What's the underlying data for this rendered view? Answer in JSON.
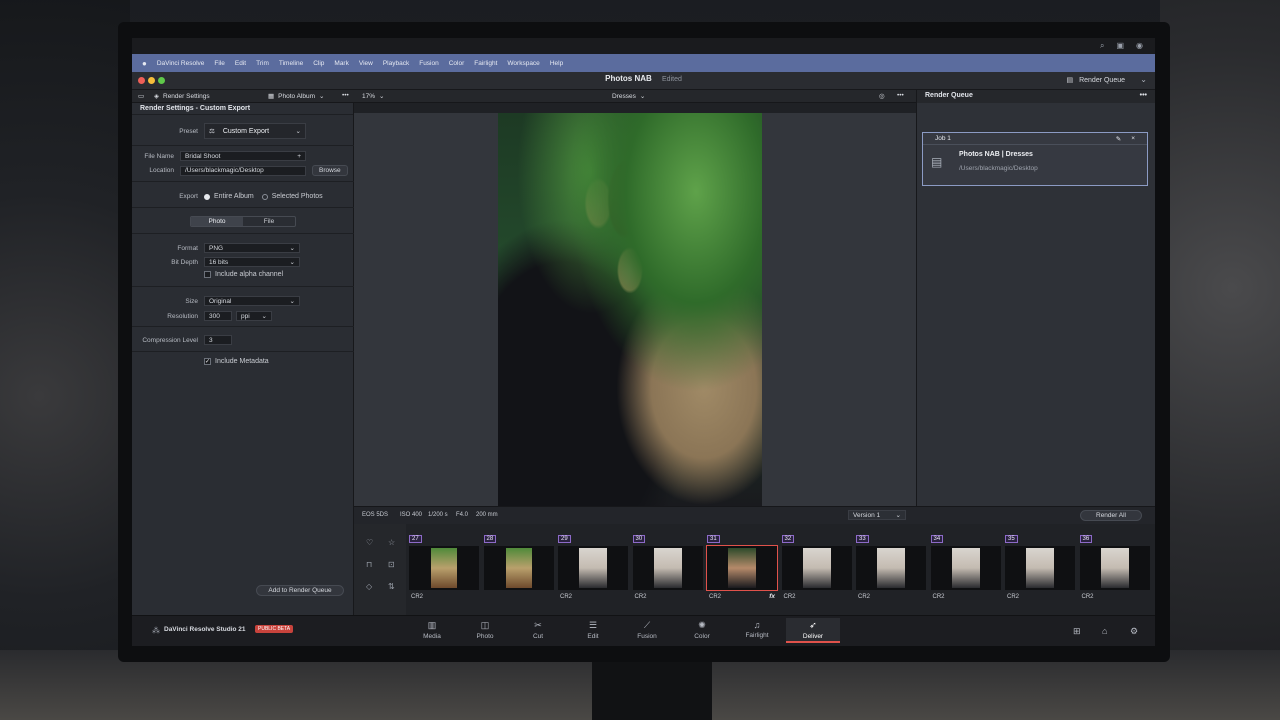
{
  "menubar": {
    "items": [
      "DaVinci Resolve",
      "File",
      "Edit",
      "Trim",
      "Timeline",
      "Clip",
      "Mark",
      "View",
      "Playback",
      "Fusion",
      "Color",
      "Fairlight",
      "Workspace",
      "Help"
    ]
  },
  "title": {
    "project": "Photos NAB",
    "status": "Edited"
  },
  "toolbar": {
    "render_settings": "Render Settings",
    "photo_album": "Photo Album",
    "zoom": "17%",
    "album": "Dresses",
    "render_queue_button": "Render Queue"
  },
  "render_settings": {
    "header": "Render Settings - Custom Export",
    "preset_label": "Preset",
    "preset_value": "Custom Export",
    "file_name_label": "File Name",
    "file_name_value": "Bridal Shoot",
    "location_label": "Location",
    "location_value": "/Users/blackmagic/Desktop",
    "browse": "Browse",
    "export_label": "Export",
    "export_entire": "Entire Album",
    "export_selected": "Selected Photos",
    "tab_photo": "Photo",
    "tab_file": "File",
    "format_label": "Format",
    "format_value": "PNG",
    "bitdepth_label": "Bit Depth",
    "bitdepth_value": "16 bits",
    "alpha_label": "Include alpha channel",
    "size_label": "Size",
    "size_value": "Original",
    "resolution_label": "Resolution",
    "resolution_value": "300",
    "resolution_unit": "ppi",
    "compression_label": "Compression Level",
    "compression_value": "3",
    "metadata_label": "Include Metadata",
    "add_to_queue": "Add to Render Queue"
  },
  "viewer_info": {
    "camera": "EOS 5DS",
    "iso": "ISO 400",
    "shutter": "1/200 s",
    "aperture": "F4.0",
    "focal": "200 mm",
    "version": "Version 1"
  },
  "render_queue": {
    "title": "Render Queue",
    "job_label": "Job 1",
    "job_title": "Photos NAB | Dresses",
    "job_path": "/Users/blackmagic/Desktop",
    "render_all": "Render All"
  },
  "filmstrip": [
    {
      "num": "27",
      "fmt": "CR2"
    },
    {
      "num": "28",
      "fmt": ""
    },
    {
      "num": "29",
      "fmt": "CR2"
    },
    {
      "num": "30",
      "fmt": "CR2"
    },
    {
      "num": "31",
      "fmt": "CR2"
    },
    {
      "num": "32",
      "fmt": "CR2"
    },
    {
      "num": "33",
      "fmt": "CR2"
    },
    {
      "num": "34",
      "fmt": "CR2"
    },
    {
      "num": "35",
      "fmt": "CR2"
    },
    {
      "num": "36",
      "fmt": "CR2"
    }
  ],
  "bottom": {
    "brand": "DaVinci Resolve Studio 21",
    "beta_badge": "PUBLIC BETA",
    "pages": [
      "Media",
      "Photo",
      "Cut",
      "Edit",
      "Fusion",
      "Color",
      "Fairlight",
      "Deliver"
    ],
    "active_page": "Deliver"
  },
  "colors": {
    "menubar": "#5b6c9e",
    "accent_red": "#e0524b",
    "job_border": "#8c9bc4",
    "clip_number": "#8d6ac8"
  }
}
